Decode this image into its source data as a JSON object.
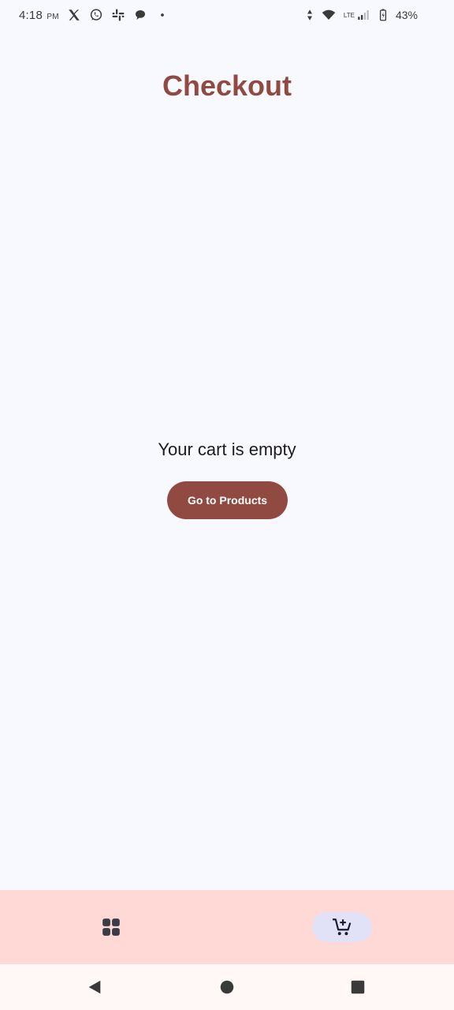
{
  "status_bar": {
    "time": "4:18",
    "ampm": "PM",
    "network": "LTE",
    "battery": "43%",
    "icons": [
      "x-icon",
      "whatsapp-icon",
      "slack-icon",
      "chat-bubble-icon",
      "dot-icon",
      "data-arrows-icon",
      "wifi-icon",
      "signal-icon",
      "battery-icon"
    ]
  },
  "header": {
    "title": "Checkout"
  },
  "main": {
    "empty_message": "Your cart is empty",
    "go_button_label": "Go to Products"
  },
  "bottom_nav": {
    "items": [
      {
        "icon": "grid-icon",
        "selected": false
      },
      {
        "icon": "add-shopping-cart-icon",
        "selected": true
      }
    ]
  },
  "system_nav": {
    "icons": [
      "back-icon",
      "home-icon",
      "recents-icon"
    ]
  },
  "colors": {
    "accent": "#904a42",
    "background": "#f8f9fe",
    "nav_bar": "#ffd9d6",
    "nav_indicator": "#e1e2f8",
    "system_nav": "#fff8f7"
  }
}
